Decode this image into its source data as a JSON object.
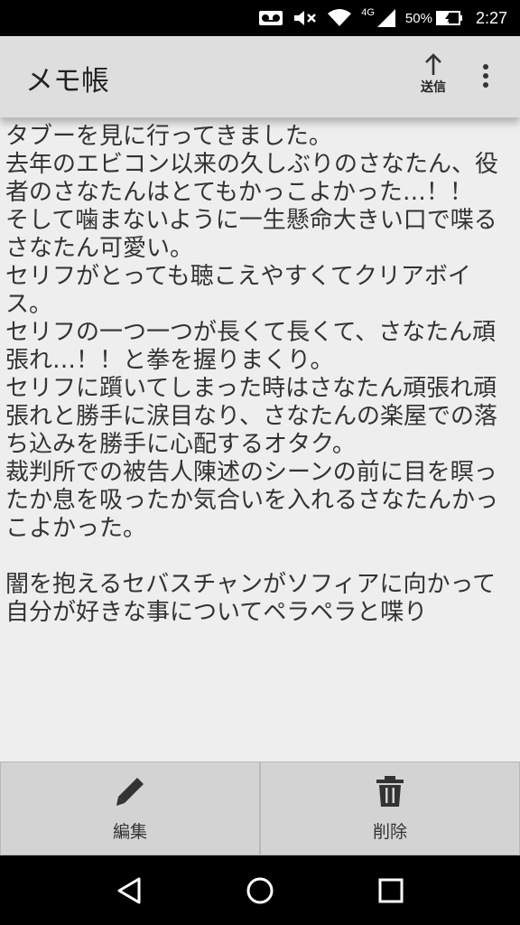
{
  "status_bar": {
    "network_label": "4G",
    "battery_percent": "50%",
    "time": "2:27"
  },
  "app_bar": {
    "title": "メモ帳",
    "send_label": "送信"
  },
  "memo": {
    "text": "タブーを見に行ってきました。\n去年のエビコン以来の久しぶりのさなたん、役者のさなたんはとてもかっこよかった…！！\nそして噛まないように一生懸命大きい口で喋るさなたん可愛い。\nセリフがとっても聴こえやすくてクリアボイス。\nセリフの一つ一つが長くて長くて、さなたん頑張れ…！！と拳を握りまくり。\nセリフに躓いてしまった時はさなたん頑張れ頑張れと勝手に涙目なり、さなたんの楽屋での落ち込みを勝手に心配するオタク。\n裁判所での被告人陳述のシーンの前に目を瞑ったか息を吸ったか気合いを入れるさなたんかっこよかった。\n\n闇を抱えるセバスチャンがソフィアに向かって自分が好きな事についてペラペラと喋り"
  },
  "actions": {
    "edit_label": "編集",
    "delete_label": "削除"
  }
}
